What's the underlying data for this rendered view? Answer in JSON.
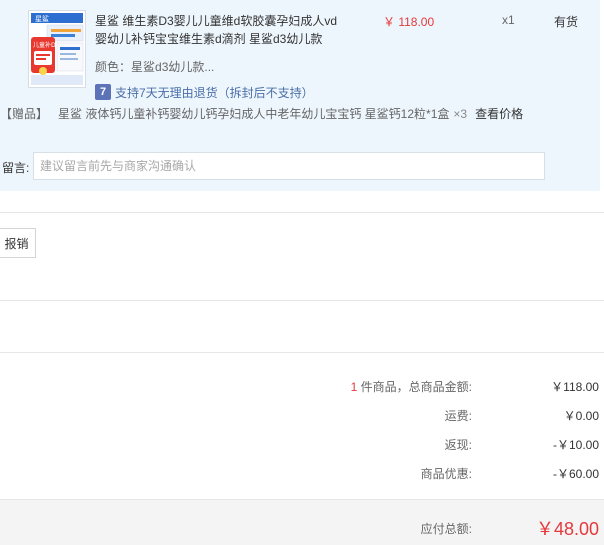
{
  "product": {
    "title": "星鲨 维生素D3婴儿儿童维d软胶囊孕妇成人vd婴幼儿补钙宝宝维生素d滴剂 星鲨d3幼儿款",
    "color_label": "颜色：",
    "color_value": "星鲨d3幼儿款...",
    "return_badge": "7",
    "return_policy": "支持7天无理由退货（拆封后不支持）",
    "price": "￥ 118.00",
    "quantity": "x1",
    "stock_status": "有货",
    "thumb_brand": "星鲨",
    "thumb_label": "儿童补D"
  },
  "gift": {
    "tag": "【赠品】",
    "text": "星鲨 液体钙儿童补钙婴幼儿钙孕妇成人中老年幼儿宝宝钙 星鲨钙12粒*1盒",
    "qty": "×3",
    "link": "查看价格"
  },
  "message": {
    "label": "留言:",
    "placeholder": "建议留言前先与商家沟通确认",
    "value": ""
  },
  "invoice": {
    "button_label": "报销"
  },
  "summary": {
    "count": "1",
    "count_suffix": " 件商品，总商品金额:",
    "goods_total": "￥118.00",
    "shipping_label": "运费:",
    "shipping": "￥0.00",
    "cashback_label": "返现:",
    "cashback": "-￥10.00",
    "discount_label": "商品优惠:",
    "discount": "-￥60.00",
    "payable_label": "应付总额:",
    "payable": "￥48.00"
  },
  "colors": {
    "panel_bg": "#eef6fd",
    "price_red": "#e4393c",
    "badge_blue": "#5c73b8"
  }
}
